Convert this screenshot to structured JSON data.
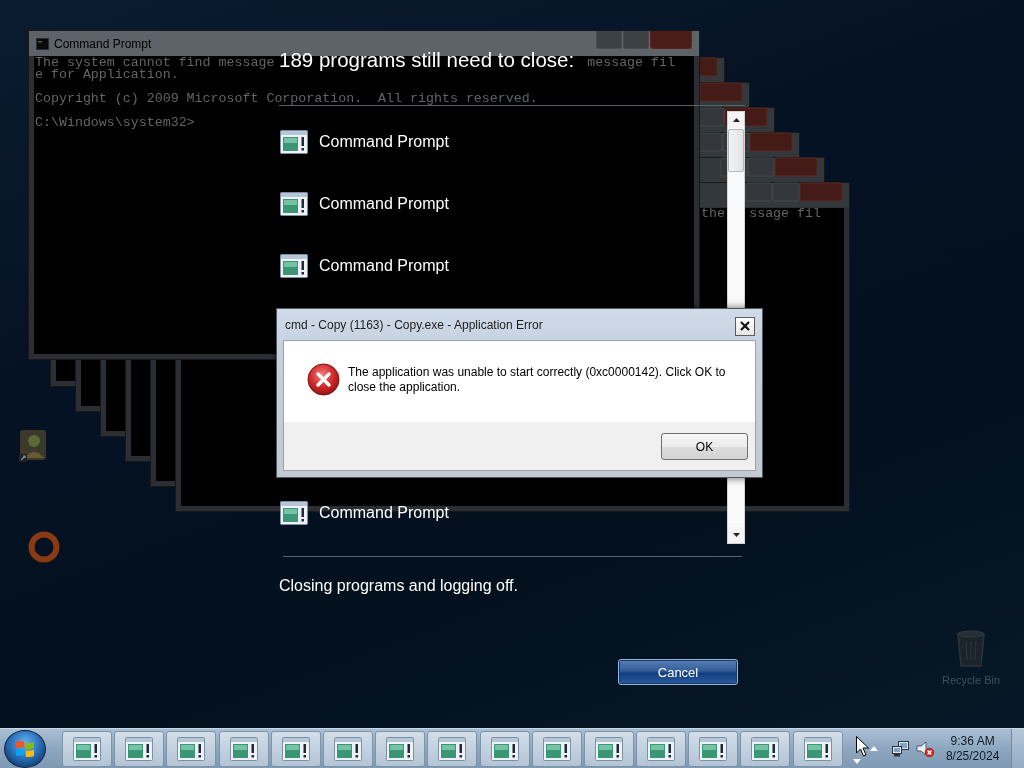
{
  "desktop": {
    "console_window": {
      "title": "Command Prompt",
      "blocks": [
        {
          "lines": [
            [
              "The system cannot find message",
              "message fil"
            ],
            [
              "e for Application."
            ]
          ]
        },
        {
          "lines": [
            [
              "Copyright (c) 2009 Microsoft Corporation.  All rights reserved."
            ]
          ]
        },
        {
          "lines": [
            [
              "C:\\Windows\\system32>"
            ]
          ]
        }
      ]
    },
    "cascade_window": {
      "segments": [
        "the",
        "ssage fil"
      ]
    },
    "recycle_bin": {
      "label": "Recycle Bin"
    }
  },
  "shutdown": {
    "heading": "189 programs still need to close:",
    "programs": [
      {
        "name": "Command Prompt"
      },
      {
        "name": "Command Prompt"
      },
      {
        "name": "Command Prompt"
      },
      {
        "name": "Command Prompt"
      }
    ],
    "status": "Closing programs and logging off.",
    "cancel_button": "Cancel"
  },
  "error_dialog": {
    "title": "cmd - Copy (1163) - Copy.exe - Application Error",
    "message": "The application was unable to start correctly (0xc0000142). Click OK to close the application.",
    "ok_button": "OK"
  },
  "taskbar": {
    "buttons": [
      {
        "selected": false
      },
      {
        "selected": false
      },
      {
        "selected": false
      },
      {
        "selected": false
      },
      {
        "selected": false
      },
      {
        "selected": false
      },
      {
        "selected": false
      },
      {
        "selected": false
      },
      {
        "selected": false
      },
      {
        "selected": false
      },
      {
        "selected": false
      },
      {
        "selected": false
      },
      {
        "selected": false
      },
      {
        "selected": false
      },
      {
        "selected": false
      }
    ],
    "volume_muted": true,
    "clock": {
      "time": "9:36 AM",
      "date": "8/25/2024"
    }
  }
}
